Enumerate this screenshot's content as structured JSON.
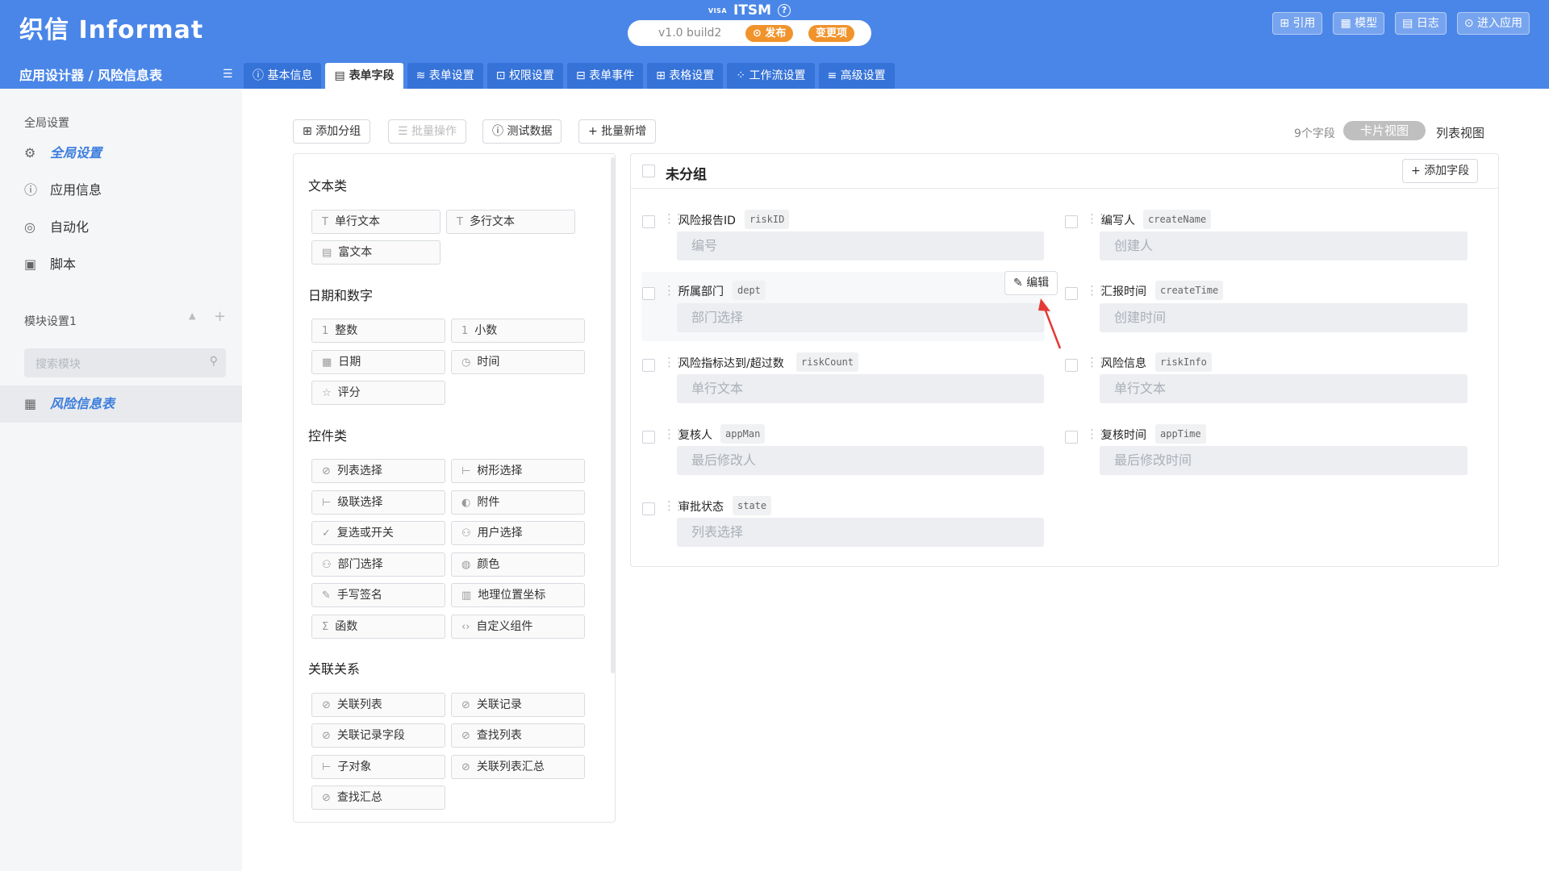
{
  "header": {
    "logo": "织信 Informat",
    "breadcrumb": "应用设计器 / 风险信息表",
    "app_badge": "VISA",
    "app_name": "ITSM",
    "version": "v1.0 build2",
    "publish_label": "发布",
    "changes_label": "变更项",
    "right_buttons": [
      "引用",
      "模型",
      "日志",
      "进入应用"
    ]
  },
  "tabs": [
    "基本信息",
    "表单字段",
    "表单设置",
    "权限设置",
    "表单事件",
    "表格设置",
    "工作流设置",
    "高级设置"
  ],
  "sidebar": {
    "global_heading": "全局设置",
    "global_items": [
      {
        "label": "全局设置",
        "icon": "gear-icon"
      },
      {
        "label": "应用信息",
        "icon": "info-icon"
      },
      {
        "label": "自动化",
        "icon": "robot-icon"
      },
      {
        "label": "脚本",
        "icon": "script-icon"
      }
    ],
    "module_heading": "模块设置1",
    "search_placeholder": "搜索模块",
    "modules": [
      {
        "label": "风险信息表",
        "icon": "table-icon"
      }
    ]
  },
  "toolbar": {
    "add_group": "添加分组",
    "batch_ops": "批量操作",
    "test_data": "测试数据",
    "batch_add": "批量新增",
    "field_count": "9个字段",
    "view_card": "卡片视图",
    "view_list": "列表视图"
  },
  "palette": {
    "categories": [
      {
        "title": "文本类",
        "items": [
          "单行文本",
          "多行文本",
          "富文本"
        ]
      },
      {
        "title": "日期和数字",
        "items": [
          "整数",
          "小数",
          "日期",
          "时间",
          "评分"
        ]
      },
      {
        "title": "控件类",
        "items": [
          "列表选择",
          "树形选择",
          "级联选择",
          "附件",
          "复选或开关",
          "用户选择",
          "部门选择",
          "颜色",
          "手写签名",
          "地理位置坐标",
          "函数",
          "自定义组件"
        ]
      },
      {
        "title": "关联关系",
        "items": [
          "关联列表",
          "关联记录",
          "关联记录字段",
          "查找列表",
          "子对象",
          "关联列表汇总",
          "查找汇总"
        ]
      }
    ]
  },
  "group": {
    "title": "未分组",
    "add_field": "添加字段",
    "edit_label": "编辑",
    "fields": [
      {
        "label": "风险报告ID",
        "key": "riskID",
        "placeholder": "编号"
      },
      {
        "label": "编写人",
        "key": "createName",
        "placeholder": "创建人"
      },
      {
        "label": "所属部门",
        "key": "dept",
        "placeholder": "部门选择"
      },
      {
        "label": "汇报时间",
        "key": "createTime",
        "placeholder": "创建时间"
      },
      {
        "label": "风险指标达到/超过数",
        "key": "riskCount",
        "placeholder": "单行文本"
      },
      {
        "label": "风险信息",
        "key": "riskInfo",
        "placeholder": "单行文本"
      },
      {
        "label": "复核人",
        "key": "appMan",
        "placeholder": "最后修改人"
      },
      {
        "label": "复核时间",
        "key": "appTime",
        "placeholder": "最后修改时间"
      },
      {
        "label": "审批状态",
        "key": "state",
        "placeholder": "列表选择"
      }
    ]
  },
  "colors": {
    "header": "#4a86e8",
    "tab": "#3673d8",
    "accent": "#3b7ddd",
    "pill": "#f0932b",
    "arrow": "#e53935"
  }
}
